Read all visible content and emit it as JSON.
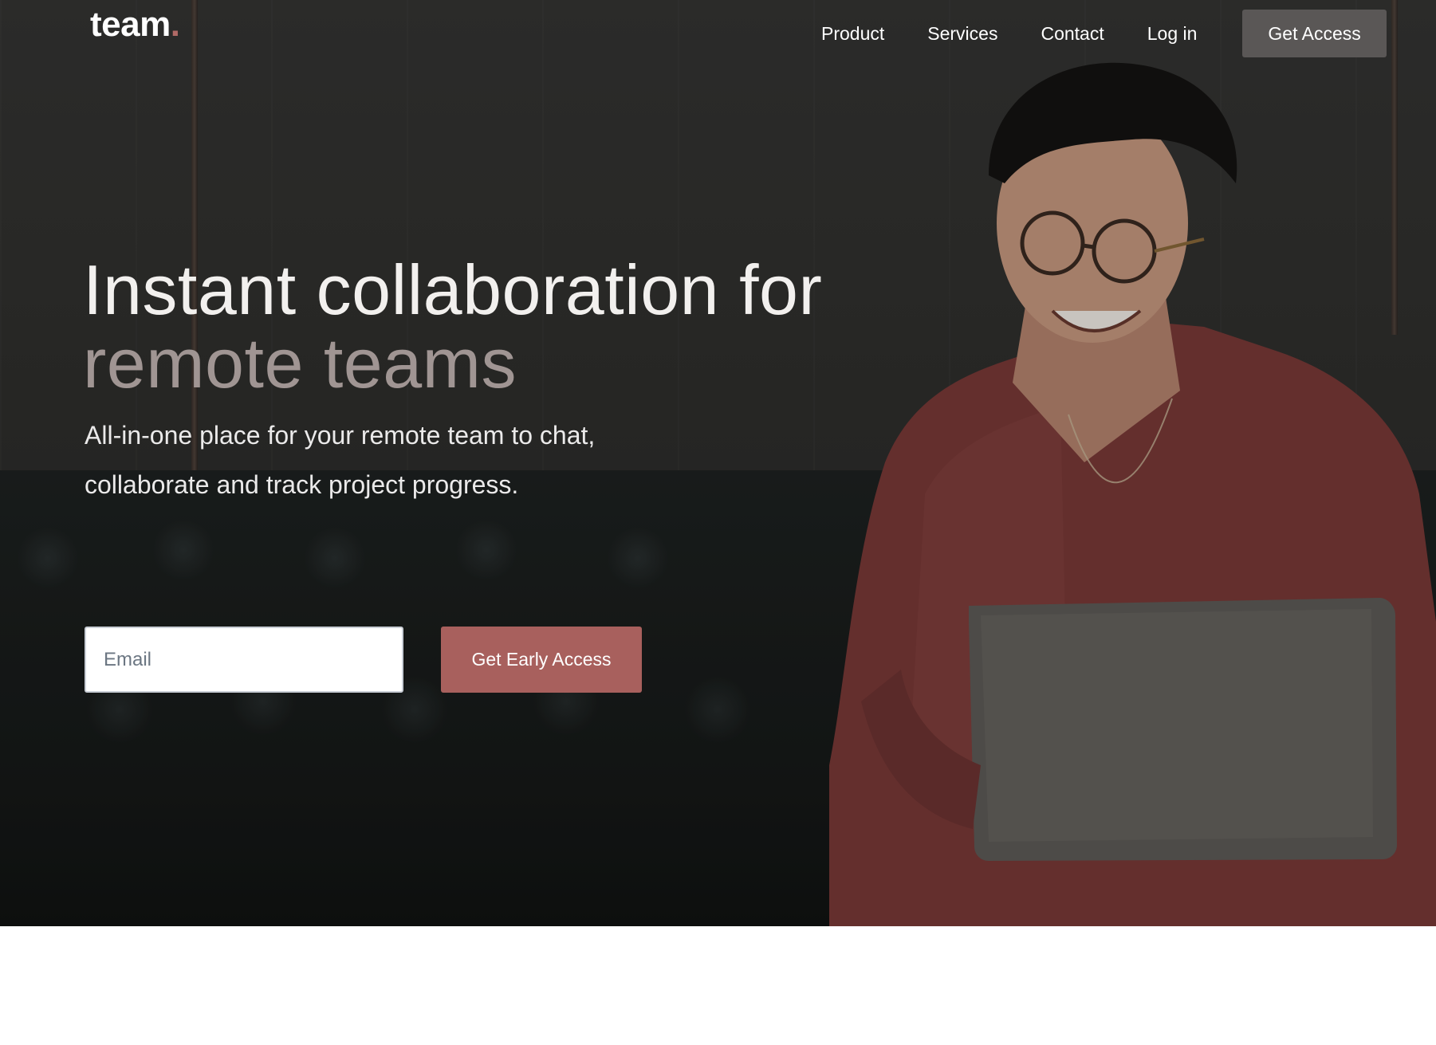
{
  "brand": {
    "name": "team",
    "dot": ".",
    "accent_color": "#b06a66"
  },
  "nav": {
    "links": [
      "Product",
      "Services",
      "Contact",
      "Log in"
    ],
    "cta_label": "Get Access"
  },
  "hero": {
    "headline_main": "Instant collaboration for",
    "headline_accent": "remote teams",
    "subheading": "All-in-one place for your remote team to chat, collaborate and track project progress.",
    "email_placeholder": "Email",
    "button_label": "Get Early Access",
    "button_color": "#a8605d"
  }
}
